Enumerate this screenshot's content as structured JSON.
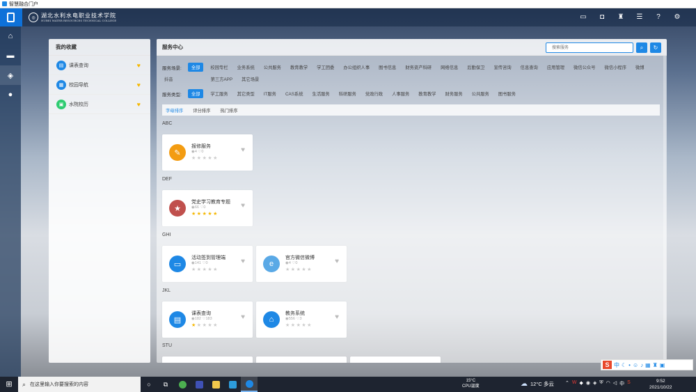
{
  "window": {
    "title": "智慧融合门户"
  },
  "header": {
    "school_name": "湖北水利水电职业技术学院",
    "school_name_en": "HUBEI WATER RESOURCES TECHNICAL COLLEGE",
    "icons": [
      "message-icon",
      "robot-icon",
      "shirt-icon",
      "grid-icon",
      "help-icon",
      "gear-icon"
    ]
  },
  "rail": {
    "items": [
      "home-icon",
      "monitor-icon",
      "cube-icon",
      "user-icon"
    ]
  },
  "favorites": {
    "title": "我的收藏",
    "items": [
      {
        "label": "课表查询",
        "color": "#1e88e5",
        "glyph": "▤"
      },
      {
        "label": "校园导航",
        "color": "#1e88e5",
        "glyph": "▦"
      },
      {
        "label": "水院校历",
        "color": "#2ecc71",
        "glyph": "▣"
      }
    ]
  },
  "services": {
    "title": "服务中心",
    "search_placeholder": "搜索服务",
    "scene_label": "服务场景:",
    "scenes": [
      "全部",
      "校园专栏",
      "业务系统",
      "公共服务",
      "教育教学",
      "学工团委",
      "办公组织人事",
      "图书信息",
      "财务资产科研",
      "网络信息",
      "后勤保卫",
      "宣传咨询",
      "信息查询",
      "应用管理",
      "微信公众号",
      "微信小程序",
      "微博",
      "抖音",
      "第三方APP",
      "其它场景"
    ],
    "type_label": "服务类型:",
    "types": [
      "全部",
      "学工服务",
      "其它类型",
      "IT服务",
      "CAS系统",
      "生活服务",
      "科研服务",
      "党政行政",
      "人事服务",
      "教育教学",
      "财务服务",
      "公共服务",
      "图书服务"
    ],
    "sort_tabs": [
      "字母排序",
      "评分排序",
      "热门排序"
    ],
    "groups": [
      {
        "label": "ABC",
        "cards": [
          {
            "name": "报修服务",
            "views": "4",
            "likes": "0",
            "stars": 0,
            "color": "#f39c12",
            "glyph": "✎"
          }
        ]
      },
      {
        "label": "DEF",
        "cards": [
          {
            "name": "党史学习教育专题",
            "views": "66",
            "likes": "0",
            "stars": 5,
            "color": "#c0504d",
            "glyph": "★"
          }
        ]
      },
      {
        "label": "GHI",
        "cards": [
          {
            "name": "活动签到管理端",
            "views": "141",
            "likes": "0",
            "stars": 0,
            "color": "#1e88e5",
            "glyph": "▭"
          },
          {
            "name": "官方微信微博",
            "views": "4",
            "likes": "0",
            "stars": 0,
            "color": "#5aa9e6",
            "glyph": "e"
          }
        ]
      },
      {
        "label": "JKL",
        "cards": [
          {
            "name": "课表查询",
            "views": "182",
            "likes": "183",
            "stars": 1,
            "color": "#1e88e5",
            "glyph": "▤"
          },
          {
            "name": "教务系统",
            "views": "556",
            "likes": "3",
            "stars": 0,
            "color": "#1e88e5",
            "glyph": "⌂"
          }
        ]
      },
      {
        "label": "STU",
        "cards": []
      }
    ]
  },
  "taskbar": {
    "search_placeholder": "在这里输入你要搜索的内容",
    "cpu_temp": "15°C",
    "cpu_label": "CPU温度",
    "weather": "12°C 多云",
    "ime": "中",
    "time": "9:52",
    "date": "2021/10/22"
  }
}
